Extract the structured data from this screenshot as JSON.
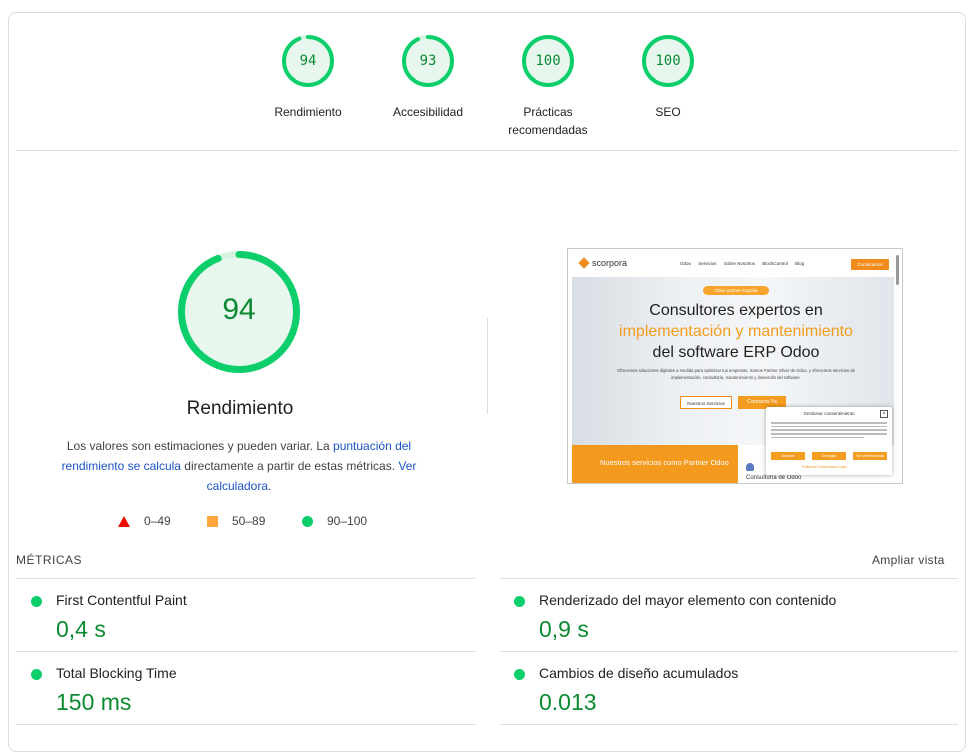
{
  "gauges": [
    {
      "score": "94",
      "label": "Rendimiento",
      "fraction": 0.94
    },
    {
      "score": "93",
      "label": "Accesibilidad",
      "fraction": 0.93
    },
    {
      "score": "100",
      "label": "Prácticas recomendadas",
      "fraction": 1.0
    },
    {
      "score": "100",
      "label": "SEO",
      "fraction": 1.0
    }
  ],
  "performance": {
    "score": "94",
    "fraction": 0.94,
    "title": "Rendimiento",
    "desc_before": "Los valores son estimaciones y pueden variar. La ",
    "desc_link1": "puntuación del rendimiento se calcula",
    "desc_middle": " directamente a partir de estas métricas. ",
    "desc_link2": "Ver calculadora",
    "desc_after": "."
  },
  "legend": {
    "fail": "0–49",
    "average": "50–89",
    "pass": "90–100"
  },
  "colors": {
    "pass": "#0cce6b",
    "pass_text": "#0c8a32",
    "average": "#ffa63d",
    "fail": "#eb0f00",
    "link": "#1a55c4"
  },
  "thumbnail": {
    "logo": "scorpora",
    "menu": [
      "Odoo",
      "Servicios",
      "Sobre Nosotros",
      "BlockControl",
      "Blog"
    ],
    "top_cta": "Contáctanos",
    "pill": "Odoo partner España",
    "headline_1": "Consultores expertos en",
    "headline_2": "implementación y mantenimiento",
    "headline_3": "del software ERP Odoo",
    "subtext": "Ofrecemos soluciones digitales a medida para optimizar tus empresas. Somos Partner Silver de Odoo, y ofrecemos servicios de implementación, consultoría, mantenimiento y desarrollo del software.",
    "btn_services": "Nuestros Servicios",
    "btn_contact": "Contacta Ya",
    "orange_text": "Nuestros servicios como Partner Odoo",
    "white_text": "Consultoría de Odoo",
    "cookie_title": "Gestionar consentimiento",
    "cookie_accept": "Aceptar",
    "cookie_deny": "Denegar",
    "cookie_prefs": "Ver preferencias",
    "cookie_links": "Política de Cookies   Aviso Legal"
  },
  "metrics": {
    "title": "MÉTRICAS",
    "expand": "Ampliar vista",
    "items": [
      {
        "name": "First Contentful Paint",
        "value": "0,4 s"
      },
      {
        "name": "Renderizado del mayor elemento con contenido",
        "value": "0,9 s"
      },
      {
        "name": "Total Blocking Time",
        "value": "150 ms"
      },
      {
        "name": "Cambios de diseño acumulados",
        "value": "0.013"
      }
    ]
  }
}
